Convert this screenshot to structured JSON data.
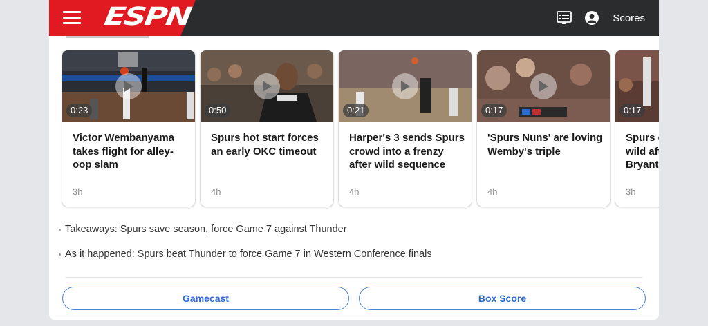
{
  "header": {
    "logo_text": "ESPN",
    "scores_label": "Scores",
    "brand_color": "#e01a20",
    "bar_color": "#2b2c2d",
    "icons": [
      "menu-icon",
      "scores-list-icon",
      "account-icon"
    ]
  },
  "videos": [
    {
      "duration": "0:23",
      "title": "Victor Wembanyama takes flight for alley-oop slam",
      "age": "3h"
    },
    {
      "duration": "0:50",
      "title": "Spurs hot start forces an early OKC timeout",
      "age": "4h"
    },
    {
      "duration": "0:21",
      "title": "Harper's 3 sends Spurs crowd into a frenzy after wild sequence",
      "age": "4h"
    },
    {
      "duration": "0:17",
      "title": "'Spurs Nuns' are loving Wemby's triple",
      "age": "4h"
    },
    {
      "duration": "0:17",
      "title": "Spurs c wild aft Bryant'",
      "age": "3h"
    }
  ],
  "headlines": [
    "Takeaways: Spurs save season, force Game 7 against Thunder",
    "As it happened: Spurs beat Thunder to force Game 7 in Western Conference finals"
  ],
  "buttons": {
    "gamecast": "Gamecast",
    "box_score": "Box Score",
    "accent": "#2f6bd0"
  }
}
